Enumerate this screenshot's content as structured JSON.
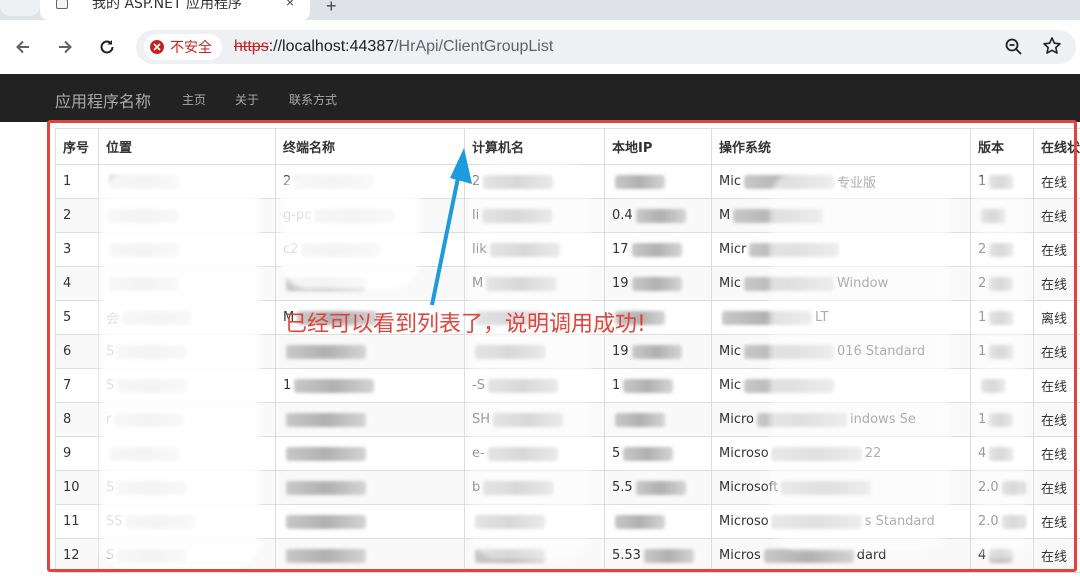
{
  "browser": {
    "tab_title": "我的 ASP.NET 应用程序",
    "tab_close": "×",
    "new_tab": "+",
    "security_label": "不安全",
    "url": {
      "scheme": "https",
      "host": "://localhost:44387",
      "path": "/HrApi/ClientGroupList"
    }
  },
  "navbar": {
    "brand": "应用程序名称",
    "links": [
      "主页",
      "关于",
      "联系方式"
    ]
  },
  "table": {
    "headers": [
      "序号",
      "位置",
      "终端名称",
      "计算机名",
      "本地IP",
      "操作系统",
      "版本",
      "在线状"
    ],
    "rows": [
      {
        "no": "1",
        "location": "",
        "terminal": "2",
        "computer": "2",
        "ip": "",
        "os": "Mic",
        "os_tail": "专业版",
        "version": "1",
        "status": "在线"
      },
      {
        "no": "2",
        "location": "",
        "terminal": "g-pc",
        "computer": "li",
        "ip": "0.4",
        "os": "M",
        "os_tail": "",
        "version": "",
        "status": "在线"
      },
      {
        "no": "3",
        "location": "",
        "terminal": "c2",
        "computer": "lik",
        "ip": "17",
        "os": "Micr",
        "os_tail": "",
        "version": "2",
        "status": "在线"
      },
      {
        "no": "4",
        "location": "",
        "terminal": "",
        "computer": "M",
        "ip": "19",
        "os": "Mic",
        "os_tail": "Window",
        "version": "2",
        "status": "在线"
      },
      {
        "no": "5",
        "location": "会",
        "terminal": "M",
        "computer": "",
        "ip": "",
        "os": "",
        "os_tail": "LT",
        "version": "1",
        "status": "离线"
      },
      {
        "no": "6",
        "location": "S",
        "terminal": "",
        "computer": "",
        "ip": "19",
        "os": "Mic",
        "os_tail": "016 Standard",
        "version": "1",
        "status": "在线"
      },
      {
        "no": "7",
        "location": "S",
        "terminal": "1",
        "computer": "-S",
        "ip": "1",
        "os": "Mic",
        "os_tail": "",
        "version": "",
        "status": "在线"
      },
      {
        "no": "8",
        "location": "r",
        "terminal": "",
        "computer": "SH",
        "ip": "",
        "os": "Micro",
        "os_tail": "indows Se",
        "version": "1",
        "status": "在线"
      },
      {
        "no": "9",
        "location": "",
        "terminal": "",
        "computer": "e-",
        "ip": "5",
        "os": "Microso",
        "os_tail": "22",
        "version": "4",
        "status": "在线"
      },
      {
        "no": "10",
        "location": "S",
        "terminal": "",
        "computer": "b",
        "ip": "5.5",
        "os": "Microsoft",
        "os_tail": "",
        "version": "2.0",
        "status": "在线"
      },
      {
        "no": "11",
        "location": "SS",
        "terminal": "",
        "computer": "",
        "ip": "",
        "os": "Microso",
        "os_tail": "s Standard",
        "version": "2.0",
        "status": "在线"
      },
      {
        "no": "12",
        "location": "S",
        "terminal": "",
        "computer": "",
        "ip": "5.53",
        "os": "Micros",
        "os_tail": "dard",
        "version": "4",
        "status": "在线"
      }
    ]
  },
  "annotation": {
    "text": "已经可以看到列表了，说明调用成功!",
    "color": "#e0443c"
  }
}
